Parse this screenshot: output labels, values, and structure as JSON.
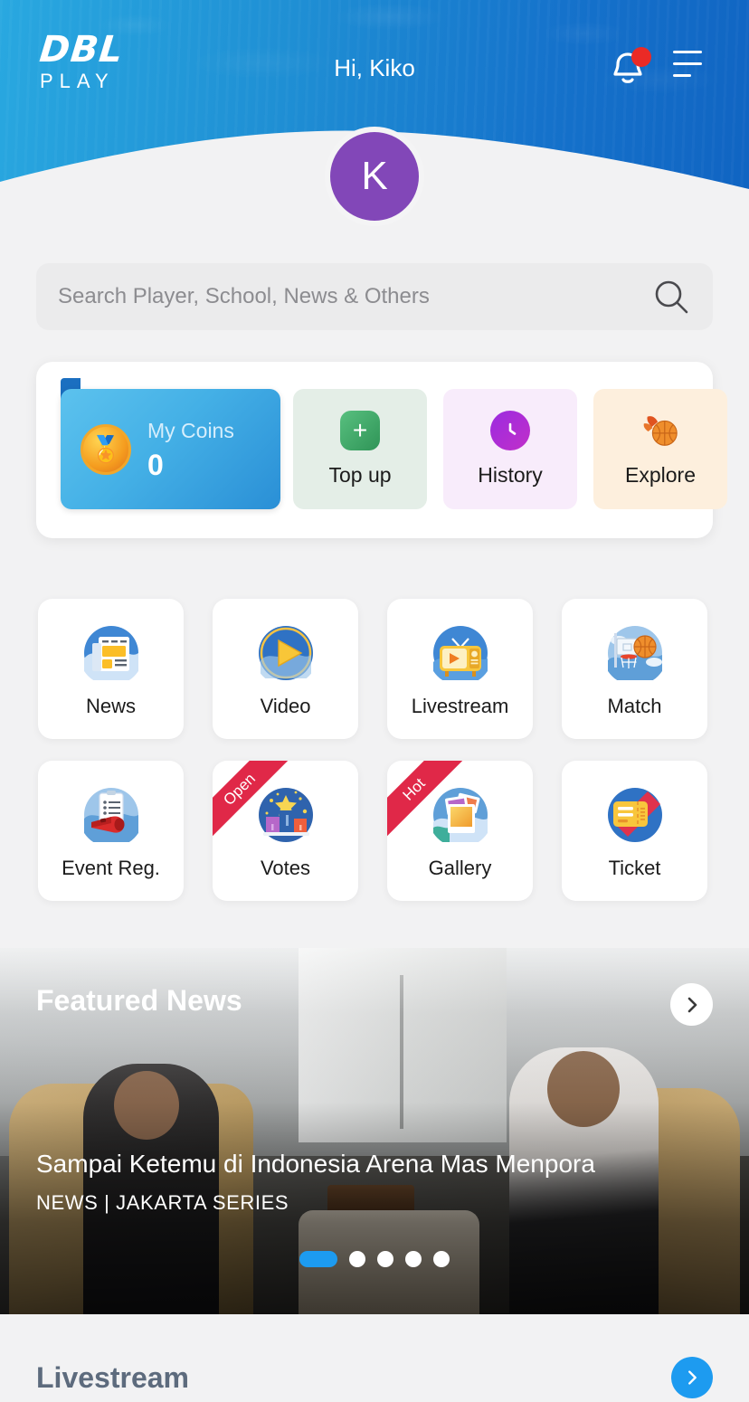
{
  "header": {
    "logo_dbl": "DBL",
    "logo_play": "PLAY",
    "greeting": "Hi, Kiko",
    "avatar_initial": "K",
    "bell_icon": "bell-icon",
    "notification_badge": "",
    "menu_icon": "hamburger-menu-icon"
  },
  "search": {
    "placeholder": "Search Player, School, News & Others",
    "value": "",
    "icon": "search-icon"
  },
  "coins": {
    "label": "My Coins",
    "value": "0",
    "coin_icon": "coin-icon",
    "actions": [
      {
        "label": "Top up",
        "icon": "plus-icon",
        "bg": "#e4eee7",
        "icon_bg": "#3ea76a",
        "icon_glyph": "+"
      },
      {
        "label": "History",
        "icon": "clock-icon",
        "bg": "#f8ecfb",
        "icon_bg": "#b12ad6",
        "icon_glyph": "◔"
      },
      {
        "label": "Explore",
        "icon": "basketball-icon",
        "bg": "#fdefdd",
        "icon_bg": "transparent",
        "icon_glyph": "🏀"
      }
    ]
  },
  "menu": {
    "row1": [
      {
        "label": "News",
        "icon": "news-icon",
        "badge": ""
      },
      {
        "label": "Video",
        "icon": "video-play-icon",
        "badge": ""
      },
      {
        "label": "Livestream",
        "icon": "tv-icon",
        "badge": ""
      },
      {
        "label": "Match",
        "icon": "hoop-icon",
        "badge": ""
      }
    ],
    "row2": [
      {
        "label": "Event Reg.",
        "icon": "whistle-icon",
        "badge": ""
      },
      {
        "label": "Votes",
        "icon": "podium-icon",
        "badge": "Open"
      },
      {
        "label": "Gallery",
        "icon": "photos-icon",
        "badge": "Hot"
      },
      {
        "label": "Ticket",
        "icon": "ticket-icon",
        "badge": ""
      }
    ]
  },
  "featured_news": {
    "section_title": "Featured News",
    "next_icon": "chevron-right-icon",
    "headline": "Sampai Ketemu di Indonesia Arena Mas Menpora",
    "meta": "NEWS  |  JAKARTA SERIES",
    "carousel": {
      "total": 5,
      "active_index": 0
    }
  },
  "livestream": {
    "section_title": "Livestream",
    "next_icon": "chevron-right-icon"
  },
  "colors": {
    "header_from": "#29a8e0",
    "header_to": "#1064c2",
    "accent_blue": "#1d9bf0",
    "avatar_purple": "#8247b8",
    "badge_red": "#ea2a26",
    "ribbon_red": "#e02848",
    "page_bg": "#f2f2f3"
  }
}
